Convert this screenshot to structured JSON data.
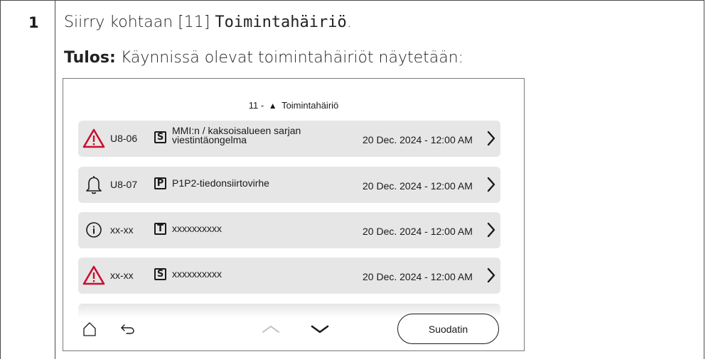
{
  "step": {
    "number": "1",
    "instruction_prefix": "Siirry kohtaan [11] ",
    "instruction_menu": "Toimintahäiriö",
    "instruction_suffix": ".",
    "result_label": "Tulos:",
    "result_text": " Käynnissä olevat toimintahäiriöt näytetään:"
  },
  "screen": {
    "title_prefix": "11 -",
    "title_icon": "warning-triangle-icon",
    "title_text": "Toimintahäiriö",
    "rows": [
      {
        "icon": "error-triangle-icon",
        "code": "U8-06",
        "type": "S",
        "description": "MMI:n / kaksoisalueen sarjan viestintäongelma",
        "datetime": "20 Dec. 2024 - 12:00 AM"
      },
      {
        "icon": "bell-icon",
        "code": "U8-07",
        "type": "P",
        "description": "P1P2-tiedonsiirtovirhe",
        "datetime": "20 Dec. 2024 - 12:00 AM"
      },
      {
        "icon": "info-icon",
        "code": "xx-xx",
        "type": "T",
        "description": "xxxxxxxxxx",
        "datetime": "20 Dec. 2024 - 12:00 AM"
      },
      {
        "icon": "error-triangle-icon",
        "code": "xx-xx",
        "type": "S",
        "description": "xxxxxxxxxx",
        "datetime": "20 Dec. 2024 - 12:00 AM"
      }
    ],
    "bottom_bar": {
      "home_icon": "home-icon",
      "back_icon": "back-arrow-icon",
      "up_icon": "chevron-up-icon",
      "down_icon": "chevron-down-icon",
      "filter_label": "Suodatin"
    },
    "colors": {
      "error_red": "#c8102e",
      "row_background": "#e6e6e6"
    }
  }
}
